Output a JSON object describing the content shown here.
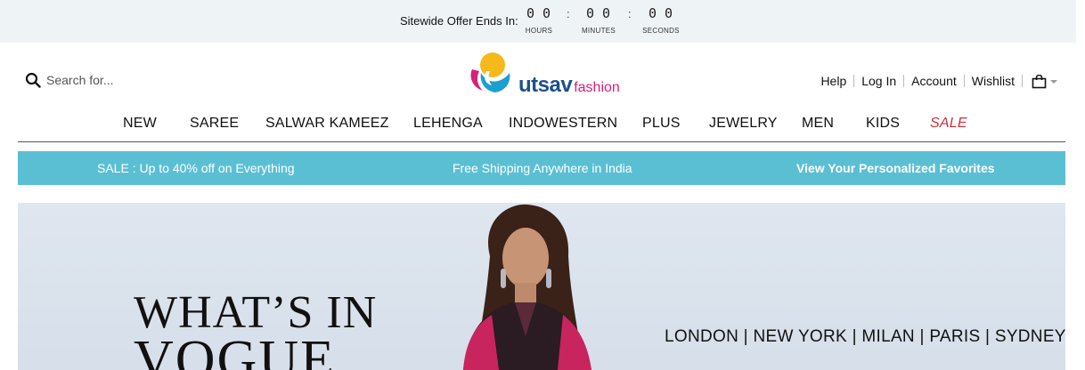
{
  "countdown": {
    "label": "Sitewide Offer Ends In:",
    "hours": "00",
    "minutes": "00",
    "seconds": "00",
    "hours_caption": "HOURS",
    "minutes_caption": "MINUTES",
    "seconds_caption": "SECONDS",
    "separator": ":"
  },
  "header": {
    "search_placeholder": "Search for...",
    "logo_main": "utsav",
    "logo_sub": "fashion",
    "links": [
      "Help",
      "Log In",
      "Account",
      "Wishlist"
    ]
  },
  "nav": {
    "items": [
      "NEW",
      "SAREE",
      "SALWAR KAMEEZ",
      "LEHENGA",
      "INDOWESTERN",
      "PLUS",
      "JEWELRY",
      "MEN",
      "KIDS",
      "SALE"
    ]
  },
  "promo": {
    "items": [
      "SALE : Up to 40% off on Everything",
      "Free Shipping Anywhere in India",
      "View Your Personalized Favorites"
    ]
  },
  "hero": {
    "title_line1": "WHAT’S IN",
    "title_line2": "VOGUE",
    "cities": "LONDON | NEW YORK | MILAN | PARIS | SYDNEY"
  },
  "colors": {
    "promo_bg": "#5bbfd4",
    "sale": "#c8343b",
    "logo_blue": "#1c4f8e",
    "logo_pink": "#d6207a",
    "offer_bg": "#eef4f6"
  }
}
